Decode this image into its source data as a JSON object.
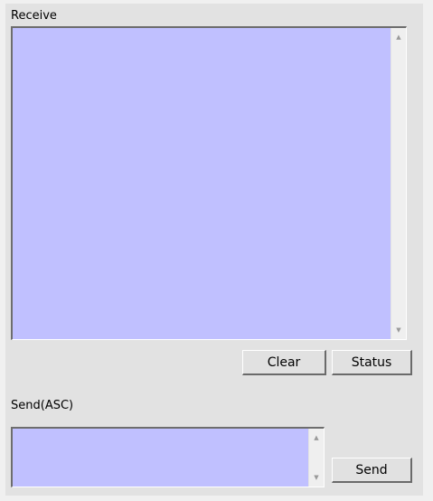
{
  "receive": {
    "label": "Receive",
    "content": "",
    "scroll_up_glyph": "▲",
    "scroll_down_glyph": "▼"
  },
  "buttons": {
    "clear_label": "Clear",
    "status_label": "Status",
    "send_label": "Send"
  },
  "send": {
    "label": "Send(ASC)",
    "content": "",
    "scroll_up_glyph": "▲",
    "scroll_down_glyph": "▼"
  },
  "colors": {
    "textarea_background": "#c0c0ff",
    "panel_background": "#e2e2e2"
  }
}
